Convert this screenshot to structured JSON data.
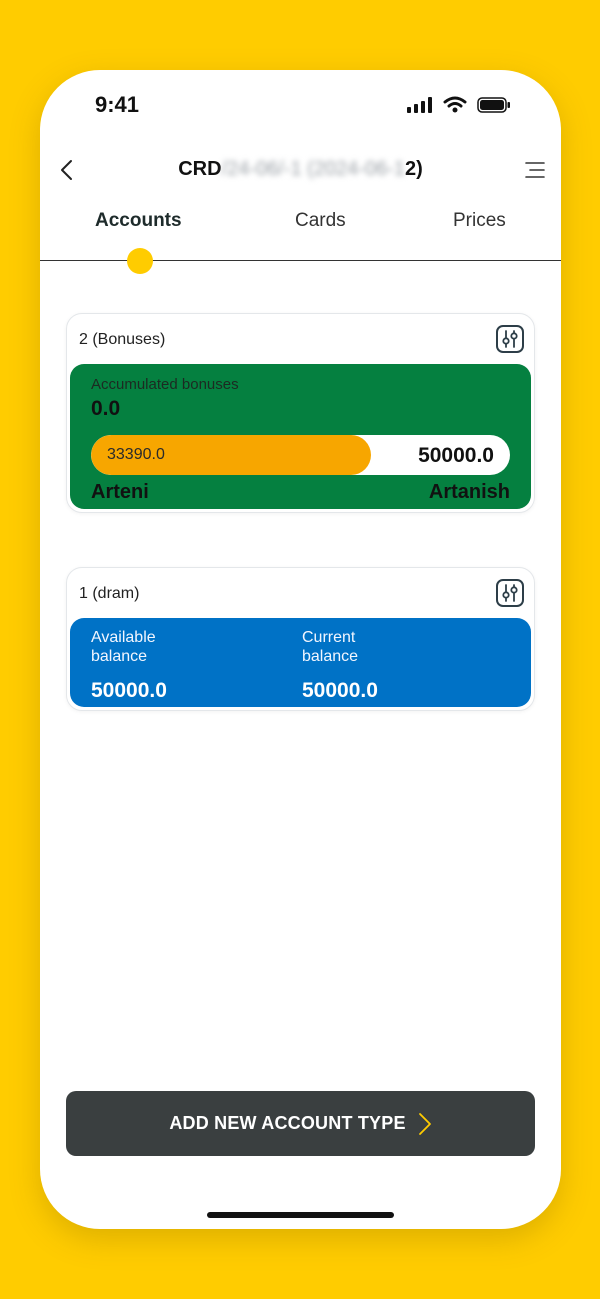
{
  "status": {
    "time": "9:41"
  },
  "header": {
    "title_prefix": "CRD",
    "title_obscured": "/24-06/-1 (2024-06-1",
    "title_suffix": "2)"
  },
  "tabs": [
    {
      "label": "Accounts",
      "active": true
    },
    {
      "label": "Cards",
      "active": false
    },
    {
      "label": "Prices",
      "active": false
    }
  ],
  "accounts": {
    "bonus": {
      "name": "2 (Bonuses)",
      "accumulated_label": "Accumulated bonuses",
      "accumulated_value": "0.0",
      "progress_current": "33390.0",
      "progress_max": "50000.0",
      "progress_fraction": 0.668,
      "level_from": "Arteni",
      "level_to": "Artanish",
      "panel_color": "#058040",
      "progress_color": "#F7A600"
    },
    "dram": {
      "name": "1 (dram)",
      "available_label": "Available balance",
      "available_value": "50000.0",
      "current_label": "Current balance",
      "current_value": "50000.0",
      "panel_color": "#0072C6"
    }
  },
  "actions": {
    "add_account_label": "ADD NEW ACCOUNT TYPE"
  },
  "colors": {
    "accent": "#FFCC00",
    "button_bg": "#3a3f40"
  },
  "icons": [
    "back-arrow-icon",
    "menu-icon",
    "settings-sliders-icon",
    "chevron-right-icon",
    "signal-icon",
    "wifi-icon",
    "battery-icon"
  ]
}
